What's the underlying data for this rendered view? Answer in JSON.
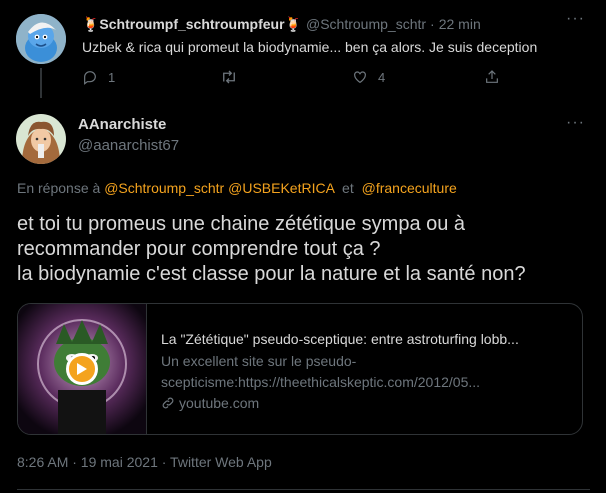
{
  "reply_tweet": {
    "display_name": "🍹Schtroumpf_schtroumpfeur🍹",
    "handle": "@Schtroump_schtr",
    "separator": "·",
    "time": "22 min",
    "text": "Uzbek & rica qui promeut la biodynamie... ben ça alors. Je suis deception",
    "reply_count": "1",
    "retweet_count": "",
    "like_count": "4"
  },
  "main_tweet": {
    "display_name": "AAnarchiste",
    "handle": "@aanarchist67",
    "reply_to_prefix": "En réponse à",
    "reply_to_1": "@Schtroump_schtr",
    "reply_to_2": "@USBEKetRICA",
    "reply_to_and": "et",
    "reply_to_3": "@franceculture",
    "text_line1": "et toi tu promeus une chaine zététique sympa ou à",
    "text_line2": "recommander pour comprendre tout ça ?",
    "text_line3": "la biodynamie c'est classe pour la nature et la santé non?",
    "card": {
      "title": "La \"Zététique\" pseudo-sceptique: entre astroturfing lobb...",
      "desc_line1": "Un excellent site sur le pseudo-",
      "desc_line2": "scepticisme:https://theethicalskeptic.com/2012/05...",
      "domain": "youtube.com"
    },
    "timestamp": "8:26 AM · 19 mai 2021 · Twitter Web App"
  },
  "colors": {
    "accent": "#f4a31e",
    "muted": "#6e767d",
    "text": "#d9d9d9",
    "background": "#000000"
  }
}
